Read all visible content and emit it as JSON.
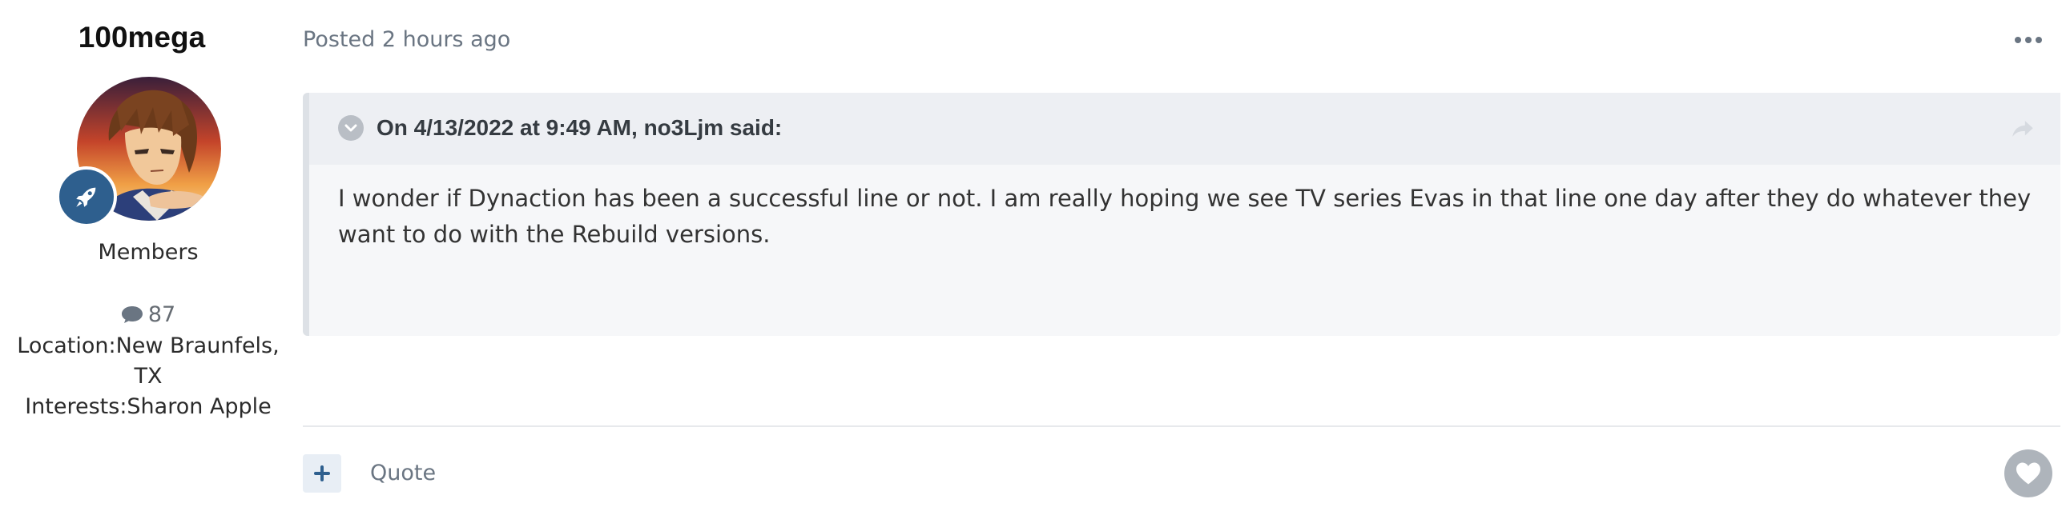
{
  "author": {
    "name": "100mega",
    "group": "Members",
    "post_count": "87",
    "location": "Location:New Braunfels, TX",
    "interests": "Interests:Sharon Apple",
    "badge_icon": "rocket-icon"
  },
  "post": {
    "meta": "Posted 2 hours ago",
    "menu_icon": "ellipsis-icon",
    "quote": {
      "citation": "On 4/13/2022 at 9:49 AM, no3Ljm said:",
      "body": "I wonder if Dynaction has been a successful line or not. I am really hoping we see TV series Evas in that line one day after they do whatever they want to do with the Rebuild versions.",
      "toggle_icon": "chevron-down-icon",
      "share_icon": "share-icon"
    }
  },
  "footer": {
    "multiquote_icon": "plus-icon",
    "quote_label": "Quote",
    "like_icon": "heart-icon"
  },
  "colors": {
    "accent": "#2e5f8e",
    "muted_text": "#6a7582",
    "quote_bg": "#f6f7f9",
    "quote_header_bg": "#edeff3"
  }
}
